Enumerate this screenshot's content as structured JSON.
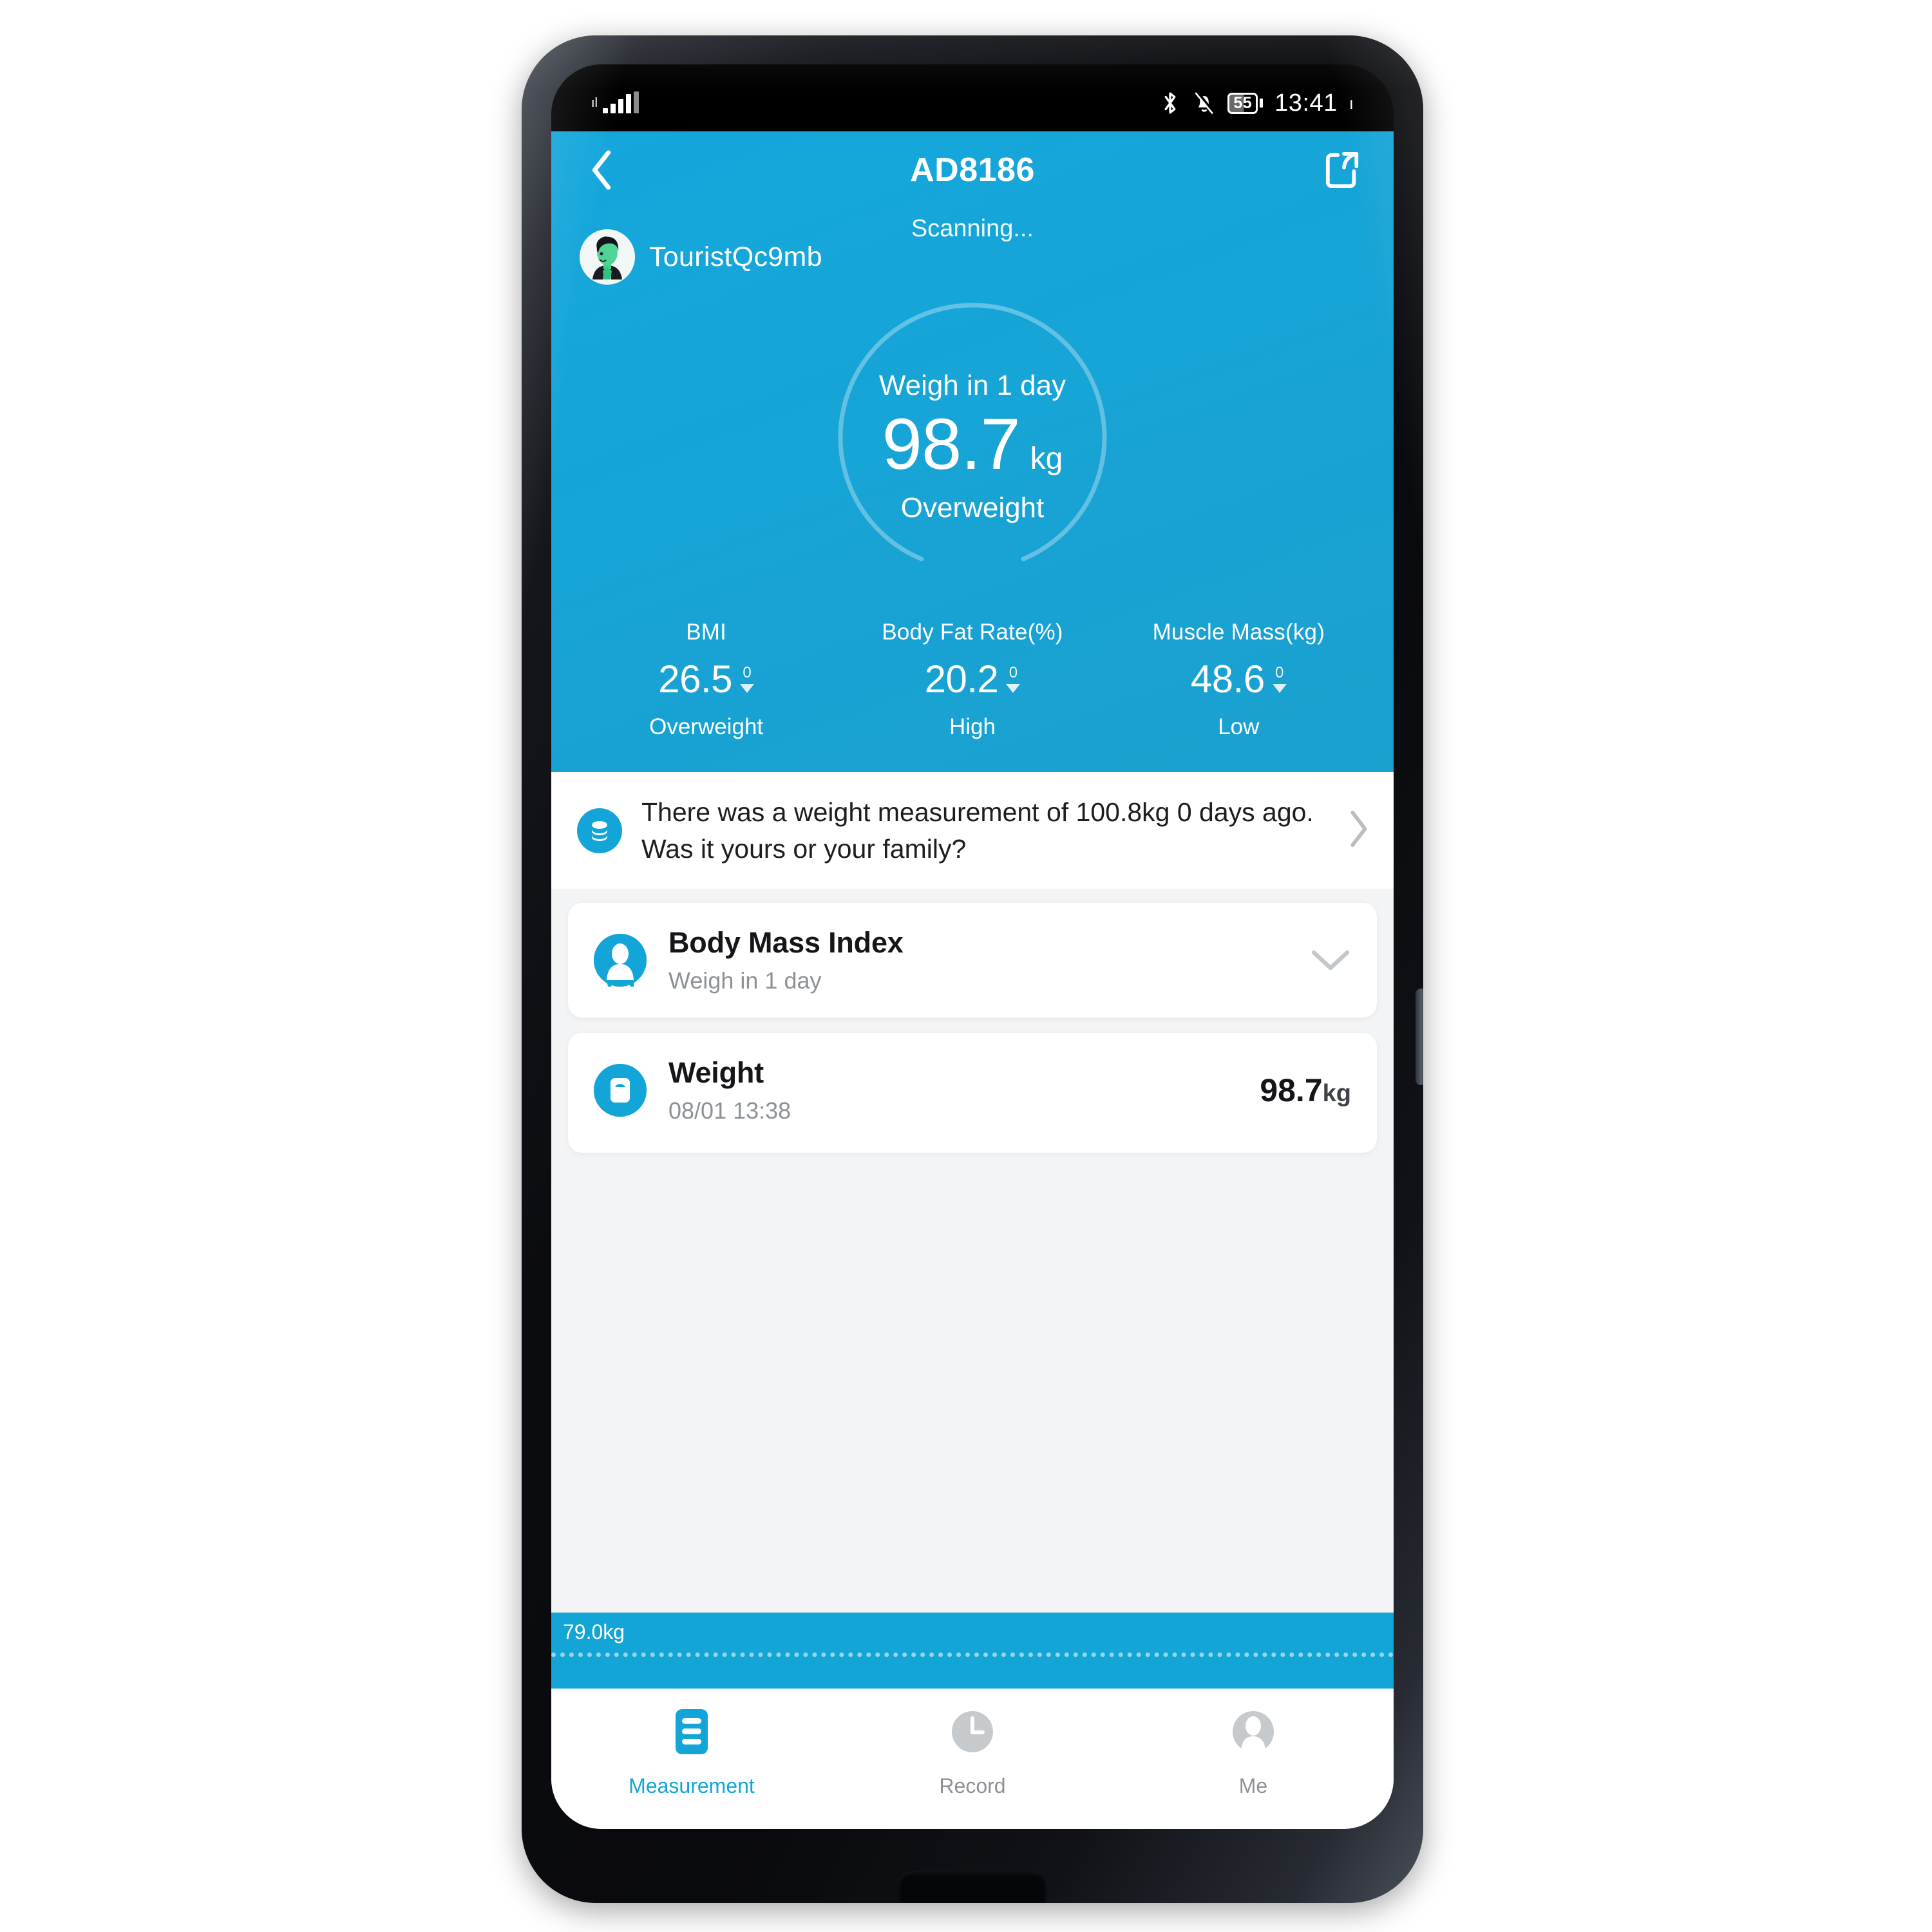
{
  "status_bar": {
    "signal_icon": "signal-bars-icon",
    "bluetooth_icon": "bluetooth-icon",
    "mute_icon": "bell-muted-icon",
    "battery_level": "55",
    "time": "13:41"
  },
  "app_bar": {
    "back_icon": "chevron-left-icon",
    "title": "AD8186",
    "share_icon": "share-icon"
  },
  "hero": {
    "scanning_text": "Scanning...",
    "avatar_icon": "user-avatar",
    "username": "TouristQc9mb",
    "gauge": {
      "label": "Weigh in 1 day",
      "value": "98.7",
      "unit": "kg",
      "status": "Overweight"
    },
    "metrics": [
      {
        "title": "BMI",
        "value": "26.5",
        "delta": "0",
        "delta_icon": "triangle-down-icon",
        "state": "Overweight"
      },
      {
        "title": "Body Fat Rate(%)",
        "value": "20.2",
        "delta": "0",
        "delta_icon": "triangle-down-icon",
        "state": "High"
      },
      {
        "title": "Muscle Mass(kg)",
        "value": "48.6",
        "delta": "0",
        "delta_icon": "triangle-down-icon",
        "state": "Low"
      }
    ]
  },
  "alert": {
    "icon": "weight-stack-icon",
    "text": "There was a weight measurement of 100.8kg 0 days ago. Was it yours or your family?",
    "chevron_icon": "chevron-right-icon"
  },
  "cards": [
    {
      "icon": "body-person-icon",
      "title": "Body Mass Index",
      "subtitle": "Weigh in 1 day",
      "trailing_icon": "chevron-down-icon"
    },
    {
      "icon": "scale-icon",
      "title": "Weight",
      "subtitle": "08/01 13:38",
      "value": "98.7",
      "value_unit": "kg"
    }
  ],
  "chart_strip": {
    "axis_label": "79.0kg"
  },
  "bottom_nav": [
    {
      "icon": "list-icon",
      "label": "Measurement",
      "active": true
    },
    {
      "icon": "clock-icon",
      "label": "Record",
      "active": false
    },
    {
      "icon": "person-icon",
      "label": "Me",
      "active": false
    }
  ],
  "colors": {
    "brand_blue": "#14a5d7",
    "hero_blue": "#17a4d6",
    "accent_text": "#13a5d8",
    "muted_text": "#8d9196",
    "dark_text": "#16161a"
  }
}
